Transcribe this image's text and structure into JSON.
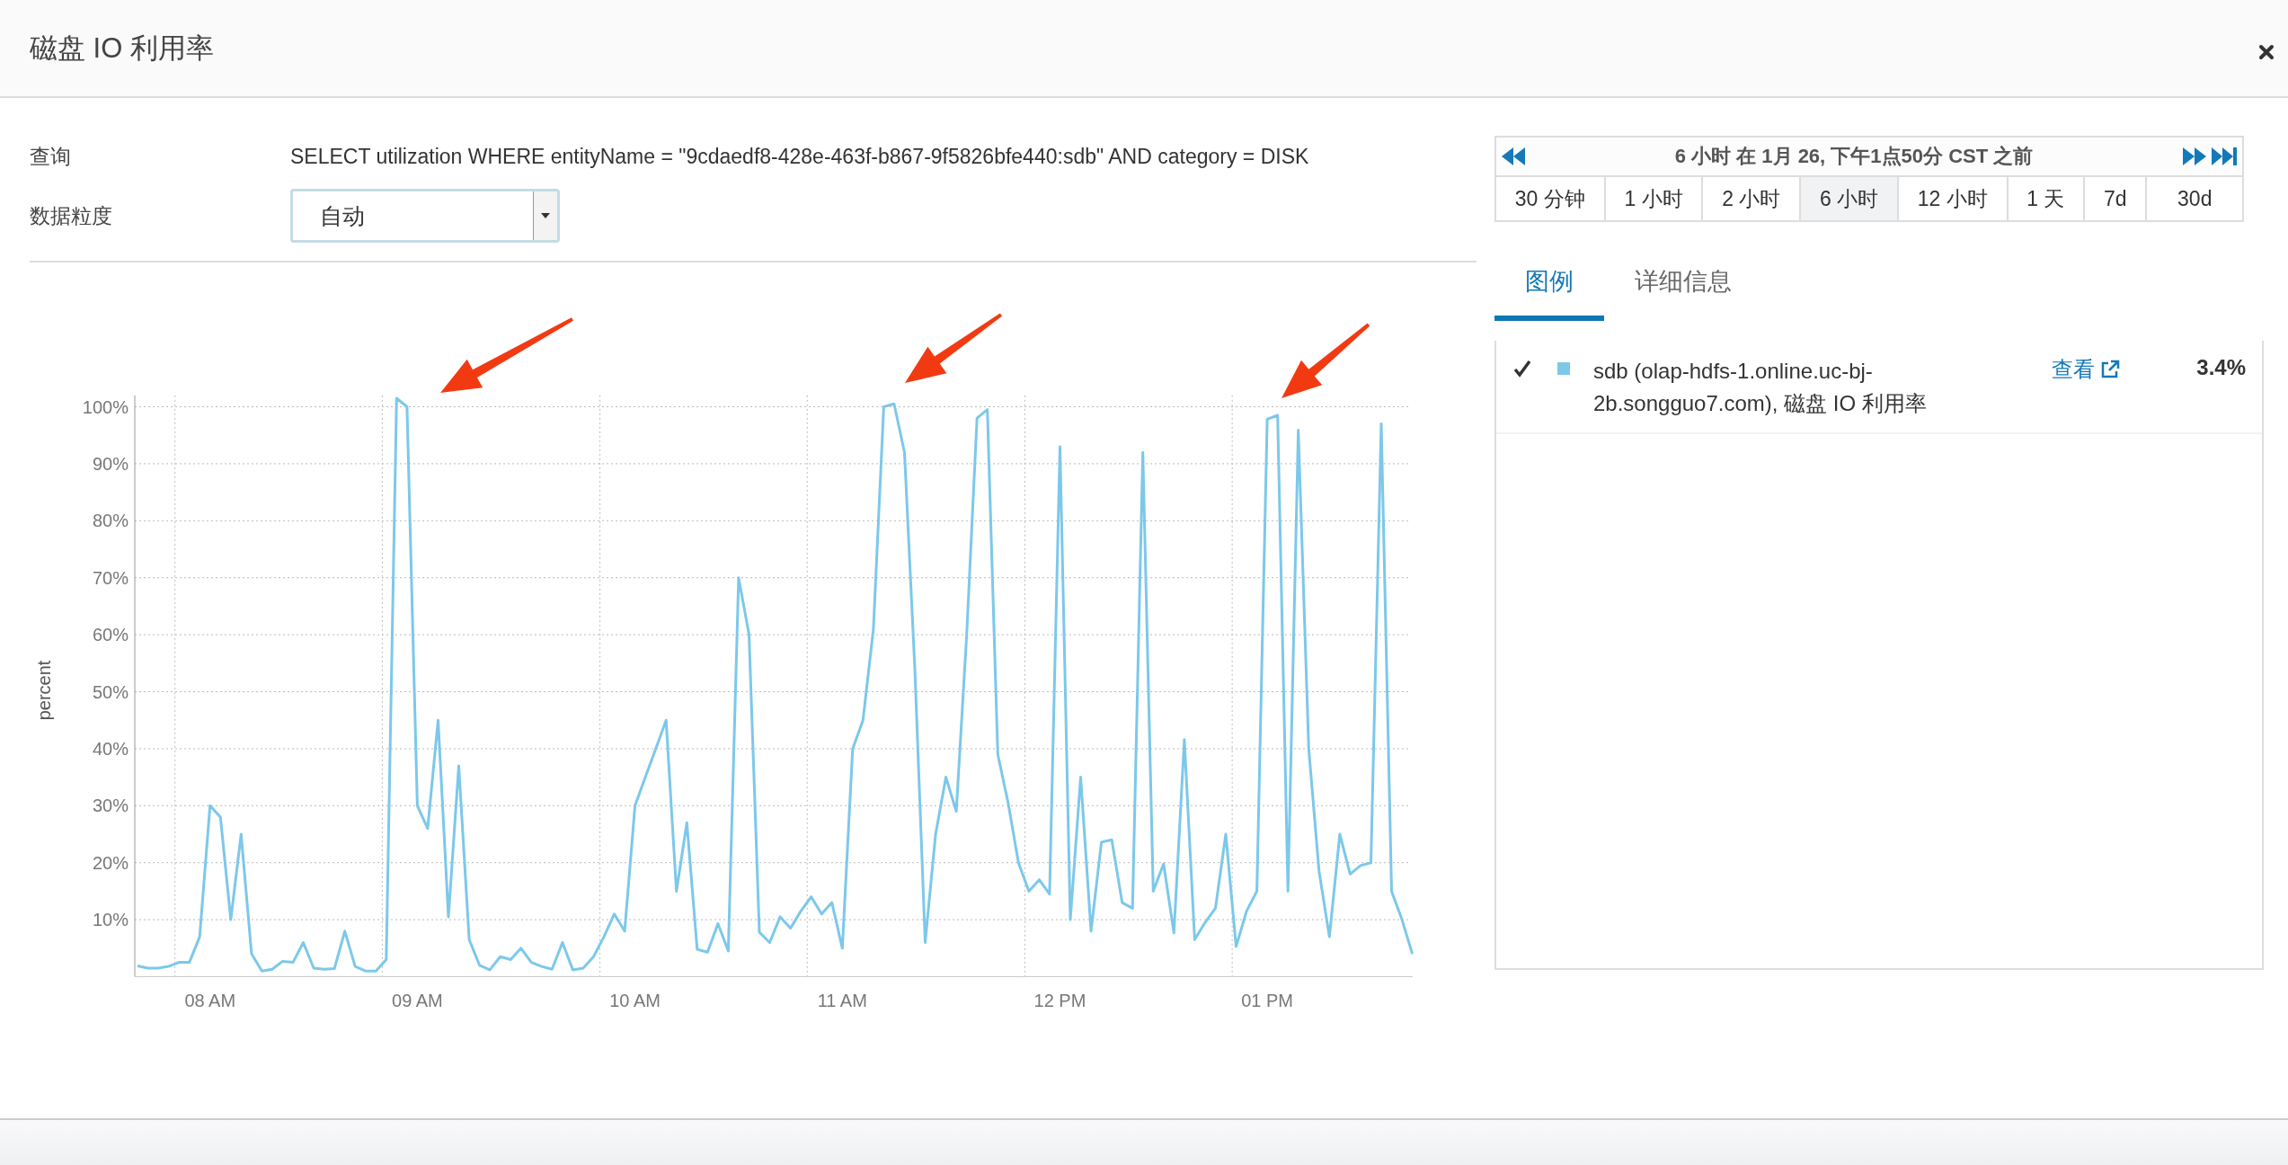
{
  "dialog": {
    "title": "磁盘 IO 利用率"
  },
  "query": {
    "label": "查询",
    "value": "SELECT utilization WHERE entityName = \"9cdaedf8-428e-463f-b867-9f5826bfe440:sdb\" AND category = DISK"
  },
  "granularity": {
    "label": "数据粒度",
    "value": "自动"
  },
  "chart_data": {
    "type": "line",
    "ylabel": "percent",
    "ylim": [
      0,
      102
    ],
    "grid": true,
    "categories": [
      null,
      null,
      null,
      null,
      null,
      null,
      null,
      "08 AM",
      null,
      null,
      null,
      null,
      null,
      null,
      null,
      null,
      null,
      null,
      null,
      null,
      null,
      null,
      null,
      null,
      null,
      null,
      null,
      "09 AM",
      null,
      null,
      null,
      null,
      null,
      null,
      null,
      null,
      null,
      null,
      null,
      null,
      null,
      null,
      null,
      null,
      null,
      null,
      null,
      null,
      "10 AM",
      null,
      null,
      null,
      null,
      null,
      null,
      null,
      null,
      null,
      null,
      null,
      null,
      null,
      null,
      null,
      null,
      null,
      null,
      null,
      "11 AM",
      null,
      null,
      null,
      null,
      null,
      null,
      null,
      null,
      null,
      null,
      null,
      null,
      null,
      null,
      null,
      null,
      null,
      null,
      null,
      null,
      "12 PM",
      null,
      null,
      null,
      null,
      null,
      null,
      null,
      null,
      null,
      null,
      null,
      null,
      null,
      null,
      null,
      null,
      null,
      null,
      null,
      "01 PM",
      null,
      null,
      null,
      null,
      null,
      null,
      null,
      null,
      null,
      null,
      null,
      null,
      null,
      null
    ],
    "yticks": [
      {
        "value": 10,
        "label": "10%"
      },
      {
        "value": 20,
        "label": "20%"
      },
      {
        "value": 30,
        "label": "30%"
      },
      {
        "value": 40,
        "label": "40%"
      },
      {
        "value": 50,
        "label": "50%"
      },
      {
        "value": 60,
        "label": "60%"
      },
      {
        "value": 70,
        "label": "70%"
      },
      {
        "value": 80,
        "label": "80%"
      },
      {
        "value": 90,
        "label": "90%"
      },
      {
        "value": 100,
        "label": "100%"
      }
    ],
    "series": [
      {
        "color": "#7cc8ea",
        "values": [
          1.9,
          1.5,
          1.5,
          1.8,
          2.5,
          2.5,
          7,
          30,
          28,
          10,
          25,
          4,
          1,
          1.3,
          2.7,
          2.5,
          6,
          1.5,
          1.3,
          1.4,
          8,
          1.8,
          1,
          1,
          3,
          101.5,
          100,
          30,
          26,
          45,
          10.5,
          37,
          6.5,
          2,
          1.2,
          3.5,
          3,
          5,
          2.5,
          1.8,
          1.3,
          6,
          1.2,
          1.5,
          3.5,
          7,
          11,
          8,
          30,
          35,
          40,
          45,
          15,
          27,
          4.8,
          4.3,
          9.3,
          4.5,
          70,
          60,
          7.8,
          6,
          10.5,
          8.5,
          11.5,
          14,
          11,
          13,
          5,
          40,
          45,
          61,
          100,
          100.5,
          92,
          54,
          6,
          25,
          35,
          29,
          60,
          98,
          99.5,
          39,
          30.5,
          20,
          15,
          17,
          14.5,
          93,
          10,
          35,
          8,
          23.6,
          24,
          13,
          12,
          92,
          15,
          19.8,
          7.7,
          41.6,
          6.5,
          9.5,
          12,
          25,
          5.3,
          11.5,
          15,
          97.8,
          98.5,
          15,
          95.9,
          40,
          18.5,
          7,
          25,
          18,
          19.5,
          20,
          97,
          15,
          10,
          4
        ]
      }
    ]
  },
  "time_range": {
    "summary": "6 小时 在 1月 26, 下午1点50分 CST 之前",
    "presets": [
      {
        "label": "30 分钟",
        "selected": false
      },
      {
        "label": "1 小时",
        "selected": false
      },
      {
        "label": "2 小时",
        "selected": false
      },
      {
        "label": "6 小时",
        "selected": true
      },
      {
        "label": "12 小时",
        "selected": false
      },
      {
        "label": "1 天",
        "selected": false
      },
      {
        "label": "7d",
        "selected": false
      },
      {
        "label": "30d",
        "selected": false
      }
    ]
  },
  "tabs": [
    {
      "label": "图例",
      "selected": true
    },
    {
      "label": "详细信息",
      "selected": false
    }
  ],
  "legend": [
    {
      "checked": true,
      "color": "#7cc8ea",
      "name": "sdb (olap-hdfs-1.online.uc-bj-2b.songguo7.com), 磁盘 IO 利用率",
      "link": "查看",
      "value": "3.4%"
    }
  ]
}
